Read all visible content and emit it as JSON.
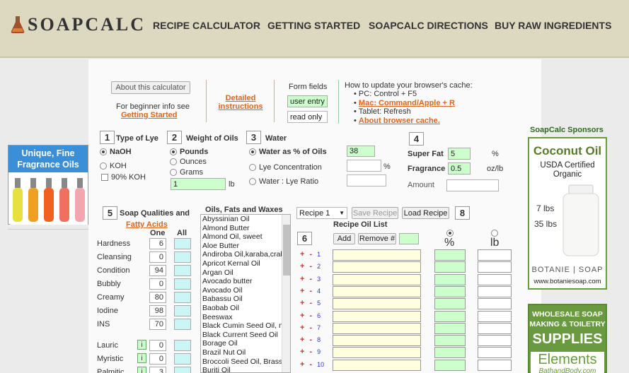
{
  "header": {
    "logo_text": "SOAPCALC",
    "nav": [
      "RECIPE CALCULATOR",
      "GETTING STARTED",
      "SOAPCALC DIRECTIONS",
      "BUY RAW INGREDIENTS"
    ]
  },
  "top": {
    "about_button": "About this calculator",
    "beginner_text": "For beginner info see",
    "getting_started_link": "Getting Started",
    "detailed_link_1": "Detailed",
    "detailed_link_2": "instructions",
    "form_fields_label": "Form fields",
    "user_entry": "user entry",
    "read_only": "read only",
    "cache_title": "How to update your browser's cache:",
    "cache_pc": "PC: Control + F5",
    "cache_mac": "Mac: Command/Apple + R",
    "cache_tablet": "Tablet: Refresh",
    "cache_about": "About browser cache."
  },
  "section1": {
    "num": "1",
    "title": "Type of Lye",
    "opt1": "NaOH",
    "opt2": "KOH",
    "opt3": "90% KOH"
  },
  "section2": {
    "num": "2",
    "title": "Weight of Oils",
    "opt1": "Pounds",
    "opt2": "Ounces",
    "opt3": "Grams",
    "value": "1",
    "unit": "lb"
  },
  "section3": {
    "num": "3",
    "title": "Water",
    "opt1": "Water as % of Oils",
    "opt1_value": "38",
    "opt2": "Lye Concentration",
    "opt2_unit": "%",
    "opt3": "Water : Lye Ratio"
  },
  "section4": {
    "num": "4",
    "superfat_label": "Super Fat",
    "superfat_value": "5",
    "superfat_unit": "%",
    "fragrance_label": "Fragrance",
    "fragrance_value": "0.5",
    "fragrance_unit": "oz/lb",
    "amount_label": "Amount"
  },
  "section5": {
    "num": "5",
    "title": "Soap Qualities and",
    "fatty_link": "Fatty Acids",
    "col_one": "One",
    "col_all": "All",
    "qualities": [
      {
        "name": "Hardness",
        "one": "6"
      },
      {
        "name": "Cleansing",
        "one": "0"
      },
      {
        "name": "Condition",
        "one": "94"
      },
      {
        "name": "Bubbly",
        "one": "0"
      },
      {
        "name": "Creamy",
        "one": "80"
      },
      {
        "name": "Iodine",
        "one": "98"
      },
      {
        "name": "INS",
        "one": "70"
      }
    ],
    "acids": [
      {
        "name": "Lauric",
        "one": "0"
      },
      {
        "name": "Myristic",
        "one": "0"
      },
      {
        "name": "Palmitic",
        "one": "3"
      }
    ],
    "info_badge": "i"
  },
  "oils": {
    "title": "Oils, Fats and Waxes",
    "items": [
      "Abyssinian Oil",
      "Almond Butter",
      "Almond Oil, sweet",
      "Aloe Butter",
      "Andiroba Oil,karaba,crabwood",
      "Apricot Kernal Oil",
      "Argan Oil",
      "Avocado butter",
      "Avocado Oil",
      "Babassu Oil",
      "Baobab Oil",
      "Beeswax",
      "Black Cumin Seed Oil, nigella sativa",
      "Black Current Seed Oil",
      "Borage Oil",
      "Brazil Nut Oil",
      "Broccoli Seed Oil, Brassica",
      "Buriti Oil"
    ]
  },
  "recipe": {
    "select_value": "Recipe 1",
    "save_button": "Save Recipe",
    "load_button": "Load Recipe",
    "num8": "8",
    "num6": "6",
    "list_title": "Recipe Oil List",
    "add_button": "Add",
    "remove_button": "Remove #",
    "pct_label": "%",
    "lb_label": "lb",
    "rows": [
      "1",
      "2",
      "3",
      "4",
      "5",
      "6",
      "7",
      "8",
      "9",
      "10"
    ]
  },
  "ads": {
    "fragrance_line1": "Unique, Fine",
    "fragrance_line2": "Fragrance Oils",
    "sponsors_title": "SoapCalc Sponsors",
    "coconut_title": "Coconut Oil",
    "coconut_sub1": "USDA Certified",
    "coconut_sub2": "Organic",
    "size1": "7 lbs",
    "size2": "35 lbs",
    "brand": "BOTANIE | SOAP",
    "url": "www.botaniesoap.com",
    "wholesale1": "WHOLESALE SOAP",
    "wholesale2": "MAKING & TOILETRY",
    "supplies": "SUPPLIES",
    "elements": "Elements",
    "elements_sub": "BathandBody.com"
  },
  "colors": {
    "accent_orange": "#d9661e",
    "green_field": "#ccffcc",
    "header_bg": "#ddd9c0",
    "sponsor_green": "#6a9a3f"
  }
}
